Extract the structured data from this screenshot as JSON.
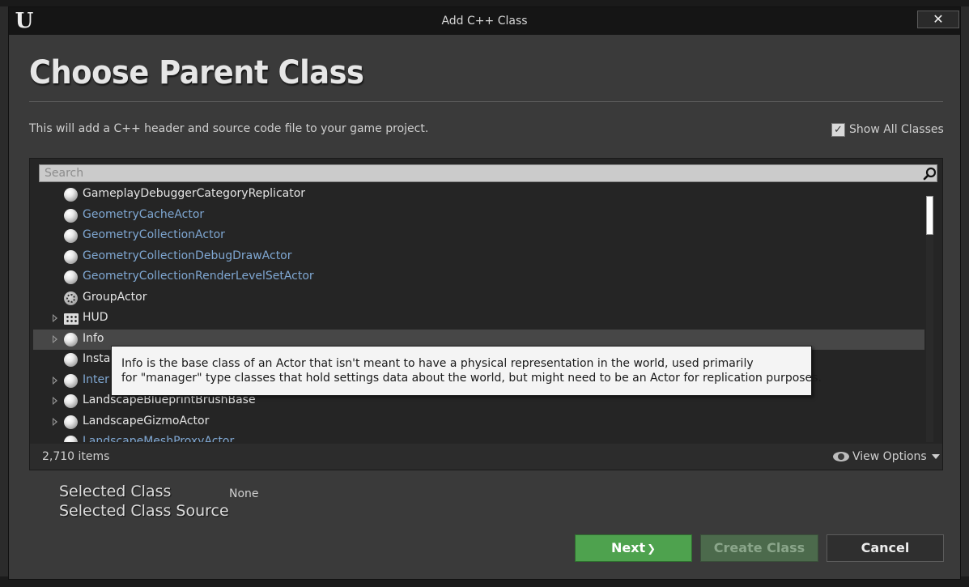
{
  "window": {
    "title": "Add C++ Class",
    "close_glyph": "✕"
  },
  "header": {
    "title": "Choose Parent Class",
    "description": "This will add a C++ header and source code file to your game project."
  },
  "options": {
    "show_all_classes_label": "Show All Classes",
    "show_all_classes_checked": true
  },
  "search": {
    "placeholder": "Search"
  },
  "class_list": {
    "items": [
      {
        "label": "GameplayDebuggerCategoryReplicator",
        "color": "white",
        "expandable": false,
        "icon": "sphere-icon"
      },
      {
        "label": "GeometryCacheActor",
        "color": "blue",
        "expandable": false,
        "icon": "sphere-icon"
      },
      {
        "label": "GeometryCollectionActor",
        "color": "blue",
        "expandable": false,
        "icon": "sphere-icon"
      },
      {
        "label": "GeometryCollectionDebugDrawActor",
        "color": "blue",
        "expandable": false,
        "icon": "sphere-icon"
      },
      {
        "label": "GeometryCollectionRenderLevelSetActor",
        "color": "blue",
        "expandable": false,
        "icon": "sphere-icon"
      },
      {
        "label": "GroupActor",
        "color": "white",
        "expandable": false,
        "icon": "group-actor-icon"
      },
      {
        "label": "HUD",
        "color": "white",
        "expandable": true,
        "icon": "hud-icon"
      },
      {
        "label": "Info",
        "color": "white",
        "expandable": true,
        "icon": "sphere-icon",
        "selected": true
      },
      {
        "label": "Insta",
        "color": "white",
        "expandable": false,
        "icon": "sphere-icon"
      },
      {
        "label": "Inter",
        "color": "blue",
        "expandable": true,
        "icon": "sphere-icon"
      },
      {
        "label": "LandscapeBlueprintBrushBase",
        "color": "white",
        "expandable": true,
        "icon": "sphere-icon"
      },
      {
        "label": "LandscapeGizmoActor",
        "color": "white",
        "expandable": true,
        "icon": "sphere-icon"
      },
      {
        "label": "LandscapeMeshProxyActor",
        "color": "blue",
        "expandable": false,
        "icon": "sphere-icon"
      }
    ],
    "item_count": "2,710 items",
    "view_options_label": "View Options"
  },
  "tooltip": {
    "line1": "Info is the base class of an Actor that isn't meant to have a physical representation in the world, used primarily",
    "line2": "for \"manager\" type classes that hold settings data about the world, but might need to be an Actor for replication purposes."
  },
  "selection": {
    "selected_class_label": "Selected Class",
    "selected_class_value": "None",
    "selected_class_source_label": "Selected Class Source"
  },
  "buttons": {
    "next": "Next",
    "create_class": "Create Class",
    "cancel": "Cancel"
  },
  "colors": {
    "accent_green": "#4ea24e",
    "link_blue": "#7fa7d2",
    "window_bg": "#3a3a3a"
  }
}
